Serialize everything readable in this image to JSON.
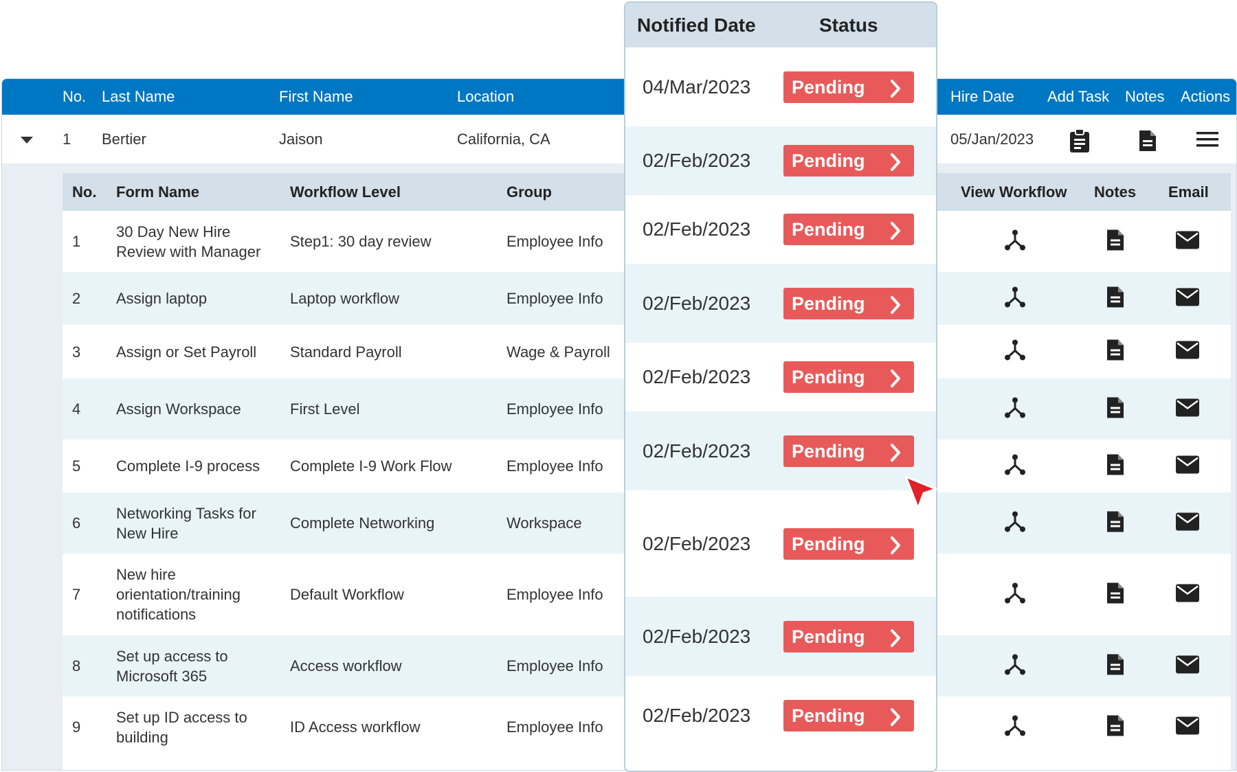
{
  "grid": {
    "headers": {
      "no": "No.",
      "last_name": "Last Name",
      "first_name": "First Name",
      "location": "Location",
      "hire_date": "Hire Date",
      "add_task": "Add Task",
      "notes": "Notes",
      "actions": "Actions"
    },
    "parent_row": {
      "no": "1",
      "last_name": "Bertier",
      "first_name": "Jaison",
      "location": "California, CA",
      "hire_date": "05/Jan/2023"
    }
  },
  "subgrid": {
    "headers": {
      "no": "No.",
      "form_name": "Form Name",
      "workflow_level": "Workflow Level",
      "group": "Group",
      "view_workflow": "View Workflow",
      "notes": "Notes",
      "email": "Email"
    },
    "rows": [
      {
        "no": "1",
        "form_name": "30 Day New Hire Review with Manager",
        "workflow_level": "Step1: 30 day review",
        "group": "Employee Info"
      },
      {
        "no": "2",
        "form_name": "Assign laptop",
        "workflow_level": "Laptop workflow",
        "group": "Employee Info"
      },
      {
        "no": "3",
        "form_name": "Assign or Set Payroll",
        "workflow_level": "Standard Payroll",
        "group": "Wage & Payroll"
      },
      {
        "no": "4",
        "form_name": "Assign Workspace",
        "workflow_level": "First Level",
        "group": "Employee Info"
      },
      {
        "no": "5",
        "form_name": "Complete I-9 process",
        "workflow_level": "Complete I-9 Work Flow",
        "group": "Employee Info"
      },
      {
        "no": "6",
        "form_name": "Networking Tasks for New Hire",
        "workflow_level": "Complete Networking",
        "group": "Workspace"
      },
      {
        "no": "7",
        "form_name": "New hire orientation/training notifications",
        "workflow_level": "Default Workflow",
        "group": "Employee Info"
      },
      {
        "no": "8",
        "form_name": "Set up access to Microsoft 365",
        "workflow_level": "Access workflow",
        "group": "Employee Info"
      },
      {
        "no": "9",
        "form_name": "Set up ID access to building",
        "workflow_level": "ID Access workflow",
        "group": "Employee Info"
      }
    ]
  },
  "status_panel": {
    "headers": {
      "notified_date": "Notified Date",
      "status": "Status"
    },
    "rows": [
      {
        "date": "04/Mar/2023",
        "status": "Pending"
      },
      {
        "date": "02/Feb/2023",
        "status": "Pending"
      },
      {
        "date": "02/Feb/2023",
        "status": "Pending"
      },
      {
        "date": "02/Feb/2023",
        "status": "Pending"
      },
      {
        "date": "02/Feb/2023",
        "status": "Pending"
      },
      {
        "date": "02/Feb/2023",
        "status": "Pending"
      },
      {
        "date": "02/Feb/2023",
        "status": "Pending"
      },
      {
        "date": "02/Feb/2023",
        "status": "Pending"
      },
      {
        "date": "02/Feb/2023",
        "status": "Pending"
      }
    ]
  },
  "icons": {
    "parent_row": [
      "clipboard-icon",
      "document-icon",
      "hamburger-menu-icon"
    ],
    "subgrid_row": [
      "workflow-icon",
      "document-icon",
      "envelope-icon"
    ],
    "status_button": "chevron-right-icon",
    "pointer": "cursor-arrow-icon"
  },
  "colors": {
    "header_blue": "#0077c2",
    "subheader": "#d3e0ea",
    "row_alt": "#e8f4f8",
    "pending_red": "#e85a5a"
  }
}
